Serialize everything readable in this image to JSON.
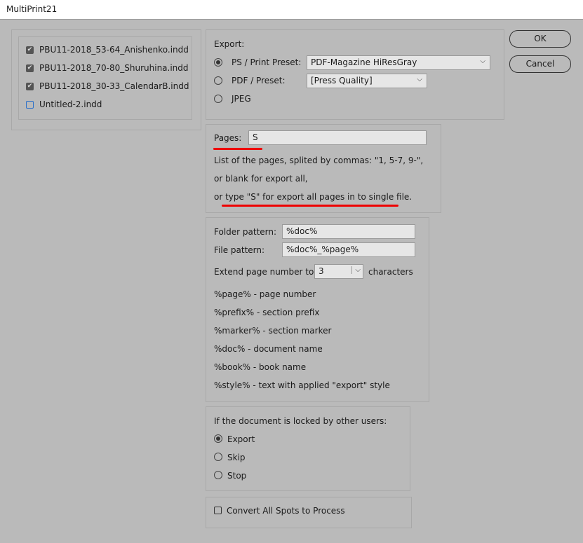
{
  "window": {
    "title": "MultiPrint21"
  },
  "documents": [
    {
      "name": "PBU11-2018_53-64_Anishenko.indd",
      "checked": true
    },
    {
      "name": "PBU11-2018_70-80_Shuruhina.indd",
      "checked": true
    },
    {
      "name": "PBU11-2018_30-33_CalendarB.indd",
      "checked": true
    },
    {
      "name": "Untitled-2.indd",
      "checked": false
    }
  ],
  "export": {
    "label": "Export:",
    "options": [
      {
        "label": "PS / Print Preset:",
        "selected": true,
        "value": "PDF-Magazine HiResGray"
      },
      {
        "label": "PDF / Preset:",
        "selected": false,
        "value": "[Press Quality]"
      },
      {
        "label": "JPEG",
        "selected": false
      }
    ]
  },
  "pages": {
    "label": "Pages:",
    "value": "S",
    "help": [
      "List of the pages, splited by commas: \"1, 5-7, 9-\",",
      "or blank for export all,",
      "or ",
      "type \"S\" for export all pages in to single file."
    ]
  },
  "patterns": {
    "folder_label": "Folder pattern:",
    "folder_value": "%doc%",
    "file_label": "File pattern:",
    "file_value": "%doc%_%page%",
    "extend_label": "Extend page number to",
    "extend_value": "3",
    "extend_suffix": "characters",
    "legend": [
      "%page% - page number",
      "%prefix% - section prefix",
      "%marker% - section marker",
      "%doc% - document name",
      "%book% - book name",
      "%style% - text with applied \"export\" style"
    ]
  },
  "locked": {
    "label": "If the document is locked by other users:",
    "options": [
      {
        "label": "Export",
        "selected": true
      },
      {
        "label": "Skip",
        "selected": false
      },
      {
        "label": "Stop",
        "selected": false
      }
    ]
  },
  "convert": {
    "label": "Convert All Spots to Process",
    "checked": false
  },
  "buttons": {
    "ok": "OK",
    "cancel": "Cancel"
  },
  "colors": {
    "annotation": "#e00000"
  }
}
